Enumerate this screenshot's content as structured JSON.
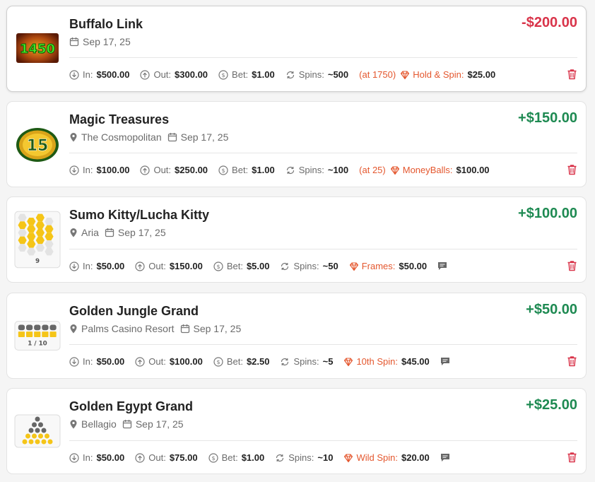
{
  "colors": {
    "negative": "#d9344a",
    "positive": "#1e8a52",
    "feature": "#e4572e",
    "delete": "#d9344a"
  },
  "labels": {
    "in": "In:",
    "out": "Out:",
    "bet": "Bet:",
    "spins": "Spins:"
  },
  "sessions": [
    {
      "game": "Buffalo Link",
      "thumbnail": "buffalo-link-1450-icon",
      "thumb_text": "1450",
      "amount": "-$200.00",
      "location": "",
      "date": "Sep 17, 25",
      "in": "$500.00",
      "out": "$300.00",
      "bet": "$1.00",
      "spins": "~500",
      "at_note": "(at 1750)",
      "feature_label": "Hold & Spin:",
      "feature_value": "$25.00",
      "has_note": false
    },
    {
      "game": "Magic Treasures",
      "thumbnail": "magic-treasures-15-badge-icon",
      "thumb_text": "15",
      "amount": "+$150.00",
      "location": "The Cosmopolitan",
      "date": "Sep 17, 25",
      "in": "$100.00",
      "out": "$250.00",
      "bet": "$1.00",
      "spins": "~100",
      "at_note": "(at 25)",
      "feature_label": "MoneyBalls:",
      "feature_value": "$100.00",
      "has_note": false
    },
    {
      "game": "Sumo Kitty/Lucha Kitty",
      "thumbnail": "hexagon-frames-icon",
      "thumb_text": "9",
      "amount": "+$100.00",
      "location": "Aria",
      "date": "Sep 17, 25",
      "in": "$50.00",
      "out": "$150.00",
      "bet": "$5.00",
      "spins": "~50",
      "at_note": "",
      "feature_label": "Frames:",
      "feature_value": "$50.00",
      "has_note": true
    },
    {
      "game": "Golden Jungle Grand",
      "thumbnail": "spin-progress-icon",
      "thumb_text": "1 / 10",
      "amount": "+$50.00",
      "location": "Palms Casino Resort",
      "date": "Sep 17, 25",
      "in": "$50.00",
      "out": "$100.00",
      "bet": "$2.50",
      "spins": "~5",
      "at_note": "",
      "feature_label": "10th Spin:",
      "feature_value": "$45.00",
      "has_note": true
    },
    {
      "game": "Golden Egypt Grand",
      "thumbnail": "pyramid-dots-icon",
      "thumb_text": "",
      "amount": "+$25.00",
      "location": "Bellagio",
      "date": "Sep 17, 25",
      "in": "$50.00",
      "out": "$75.00",
      "bet": "$1.00",
      "spins": "~10",
      "at_note": "",
      "feature_label": "Wild Spin:",
      "feature_value": "$20.00",
      "has_note": true
    }
  ]
}
